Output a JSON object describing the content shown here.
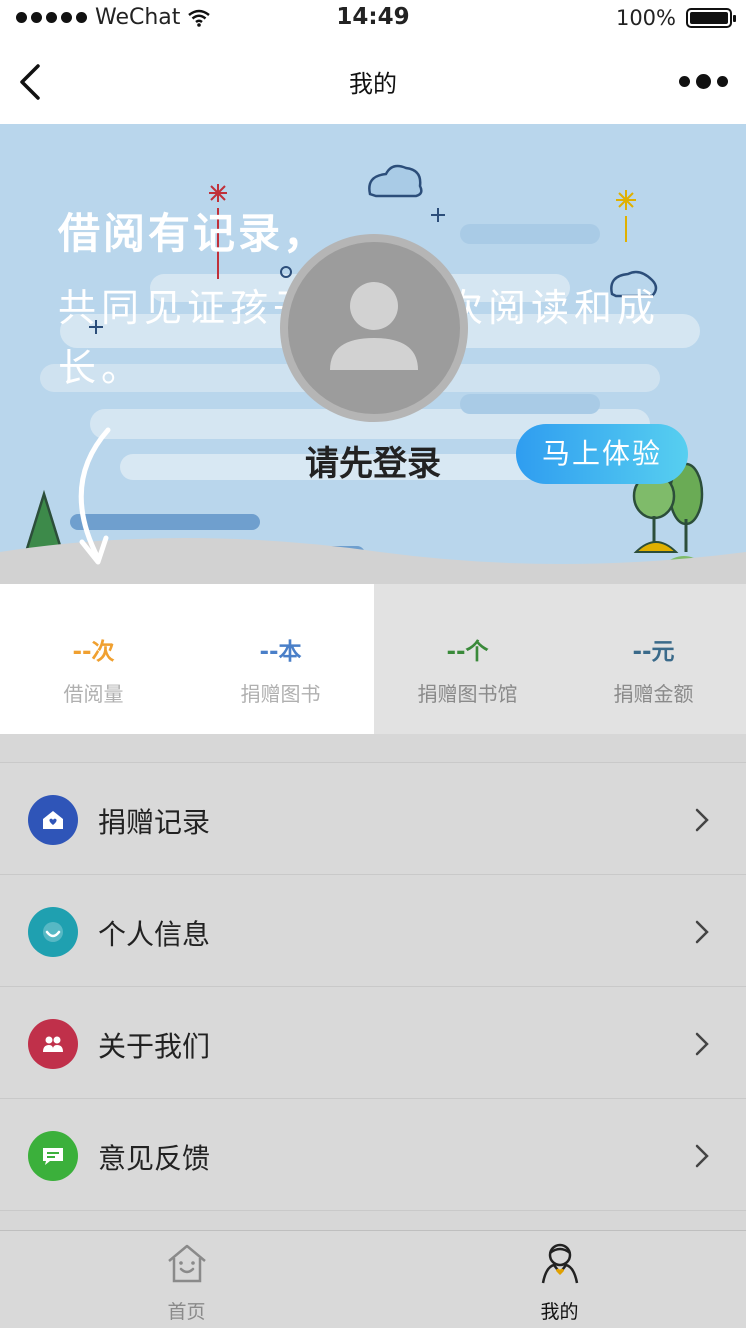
{
  "status_bar": {
    "carrier": "WeChat",
    "time": "14:49",
    "battery": "100%"
  },
  "nav": {
    "title": "我的",
    "back_icon": "chevron-left-icon",
    "more_icon": "more-dots-icon"
  },
  "hero": {
    "title": "借阅有记录，",
    "subtitle": "共同见证孩子的每一次阅读和成长。",
    "login_prompt": "请先登录",
    "try_button": "马上体验"
  },
  "stats": [
    {
      "value": "--次",
      "label": "借阅量",
      "color": "#f0a030"
    },
    {
      "value": "--本",
      "label": "捐赠图书",
      "color": "#4a7fc8"
    },
    {
      "value": "--个",
      "label": "捐赠图书馆",
      "color": "#3a8a3a"
    },
    {
      "value": "--元",
      "label": "捐赠金额",
      "color": "#3a6a8a"
    }
  ],
  "menu": [
    {
      "label": "捐赠记录",
      "icon": "donation-home-icon",
      "color": "#2f55b8"
    },
    {
      "label": "个人信息",
      "icon": "smile-face-icon",
      "color": "#1fa0b0"
    },
    {
      "label": "关于我们",
      "icon": "people-icon",
      "color": "#c0304a"
    },
    {
      "label": "意见反馈",
      "icon": "chat-bubble-icon",
      "color": "#3bb03b"
    }
  ],
  "tabbar": [
    {
      "label": "首页",
      "icon": "home-icon"
    },
    {
      "label": "我的",
      "icon": "profile-icon"
    }
  ]
}
